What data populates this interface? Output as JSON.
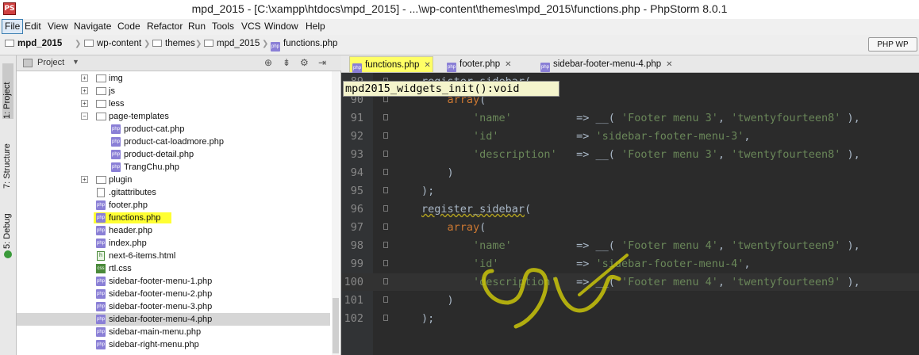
{
  "window": {
    "title": "mpd_2015 - [C:\\xampp\\htdocs\\mpd_2015] - ...\\wp-content\\themes\\mpd_2015\\functions.php - PhpStorm 8.0.1",
    "app_icon_text": "PS"
  },
  "menu": [
    "File",
    "Edit",
    "View",
    "Navigate",
    "Code",
    "Refactor",
    "Run",
    "Tools",
    "VCS",
    "Window",
    "Help"
  ],
  "breadcrumbs": [
    "mpd_2015",
    "wp-content",
    "themes",
    "mpd_2015",
    "functions.php"
  ],
  "toolbar": {
    "php_web_label": "PHP WP"
  },
  "side_tabs": [
    "1: Project",
    "7: Structure",
    "5: Debug"
  ],
  "project_panel": {
    "title": "Project",
    "tree": [
      {
        "name": "img",
        "type": "folder",
        "level": 1,
        "expander": "+"
      },
      {
        "name": "js",
        "type": "folder",
        "level": 1,
        "expander": "+"
      },
      {
        "name": "less",
        "type": "folder",
        "level": 1,
        "expander": "+"
      },
      {
        "name": "page-templates",
        "type": "folder",
        "level": 1,
        "expander": "-"
      },
      {
        "name": "product-cat.php",
        "type": "php",
        "level": 2
      },
      {
        "name": "product-cat-loadmore.php",
        "type": "php",
        "level": 2
      },
      {
        "name": "product-detail.php",
        "type": "php",
        "level": 2
      },
      {
        "name": "TrangChu.php",
        "type": "php",
        "level": 2
      },
      {
        "name": "plugin",
        "type": "folder",
        "level": 1,
        "expander": "+"
      },
      {
        "name": ".gitattributes",
        "type": "file",
        "level": 1
      },
      {
        "name": "footer.php",
        "type": "php",
        "level": 1
      },
      {
        "name": "functions.php",
        "type": "php",
        "level": 1,
        "highlighted": true
      },
      {
        "name": "header.php",
        "type": "php",
        "level": 1
      },
      {
        "name": "index.php",
        "type": "php",
        "level": 1
      },
      {
        "name": "next-6-items.html",
        "type": "html",
        "level": 1
      },
      {
        "name": "rtl.css",
        "type": "css",
        "level": 1
      },
      {
        "name": "sidebar-footer-menu-1.php",
        "type": "php",
        "level": 1
      },
      {
        "name": "sidebar-footer-menu-2.php",
        "type": "php",
        "level": 1
      },
      {
        "name": "sidebar-footer-menu-3.php",
        "type": "php",
        "level": 1
      },
      {
        "name": "sidebar-footer-menu-4.php",
        "type": "php",
        "level": 1,
        "selected": true
      },
      {
        "name": "sidebar-main-menu.php",
        "type": "php",
        "level": 1
      },
      {
        "name": "sidebar-right-menu.php",
        "type": "php",
        "level": 1
      }
    ]
  },
  "editor_tabs": [
    {
      "name": "functions.php",
      "active": true
    },
    {
      "name": "footer.php",
      "active": false
    },
    {
      "name": "sidebar-footer-menu-4.php",
      "active": false
    }
  ],
  "editor": {
    "function_breadcrumb": "mpd2015_widgets_init():void",
    "lines": [
      {
        "num": "89",
        "indent": "",
        "tokens": [
          [
            "fn",
            "register_sidebar"
          ],
          [
            "punc",
            "("
          ]
        ]
      },
      {
        "num": "90",
        "indent": "    ",
        "tokens": [
          [
            "kw",
            "array"
          ],
          [
            "punc",
            "("
          ]
        ]
      },
      {
        "num": "91",
        "indent": "        ",
        "tokens": [
          [
            "str",
            "'name'"
          ],
          [
            "op",
            "          => "
          ],
          [
            "punc",
            "__( "
          ],
          [
            "str",
            "'Footer menu 3'"
          ],
          [
            "punc",
            ", "
          ],
          [
            "str",
            "'twentyfourteen8'"
          ],
          [
            "punc",
            " ),"
          ]
        ]
      },
      {
        "num": "92",
        "indent": "        ",
        "tokens": [
          [
            "str",
            "'id'"
          ],
          [
            "op",
            "            => "
          ],
          [
            "str",
            "'sidebar-footer-menu-3'"
          ],
          [
            "punc",
            ","
          ]
        ]
      },
      {
        "num": "93",
        "indent": "        ",
        "tokens": [
          [
            "str",
            "'description'"
          ],
          [
            "op",
            "   => "
          ],
          [
            "punc",
            "__( "
          ],
          [
            "str",
            "'Footer menu 3'"
          ],
          [
            "punc",
            ", "
          ],
          [
            "str",
            "'twentyfourteen8'"
          ],
          [
            "punc",
            " ),"
          ]
        ]
      },
      {
        "num": "94",
        "indent": "    ",
        "tokens": [
          [
            "punc",
            ")"
          ]
        ]
      },
      {
        "num": "95",
        "indent": "",
        "tokens": [
          [
            "punc",
            ");"
          ]
        ]
      },
      {
        "num": "96",
        "indent": "",
        "tokens": [
          [
            "fn",
            "register_sidebar"
          ],
          [
            "punc",
            "("
          ]
        ]
      },
      {
        "num": "97",
        "indent": "    ",
        "tokens": [
          [
            "kw",
            "array"
          ],
          [
            "punc",
            "("
          ]
        ]
      },
      {
        "num": "98",
        "indent": "        ",
        "tokens": [
          [
            "str",
            "'name'"
          ],
          [
            "op",
            "          => "
          ],
          [
            "punc",
            "__( "
          ],
          [
            "str",
            "'Footer menu 4'"
          ],
          [
            "punc",
            ", "
          ],
          [
            "str",
            "'twentyfourteen9'"
          ],
          [
            "punc",
            " ),"
          ]
        ]
      },
      {
        "num": "99",
        "indent": "        ",
        "tokens": [
          [
            "str",
            "'id'"
          ],
          [
            "op",
            "            => "
          ],
          [
            "str",
            "'sidebar-footer-menu-4'"
          ],
          [
            "punc",
            ","
          ]
        ]
      },
      {
        "num": "100",
        "indent": "        ",
        "tokens": [
          [
            "str",
            "'description'"
          ],
          [
            "op",
            "   => "
          ],
          [
            "punc",
            "__( "
          ],
          [
            "str",
            "'Footer menu 4'"
          ],
          [
            "punc",
            ", "
          ],
          [
            "str",
            "'twentyfourteen9'"
          ],
          [
            "punc",
            " ),"
          ]
        ],
        "current": true
      },
      {
        "num": "101",
        "indent": "    ",
        "tokens": [
          [
            "punc",
            ")"
          ]
        ]
      },
      {
        "num": "102",
        "indent": "",
        "tokens": [
          [
            "punc",
            ");"
          ]
        ]
      }
    ]
  },
  "colors": {
    "highlight": "#ffff33",
    "editor_bg": "#2b2b2b",
    "string": "#6a8759",
    "keyword": "#cc7832",
    "scribble": "#c9c40a"
  }
}
